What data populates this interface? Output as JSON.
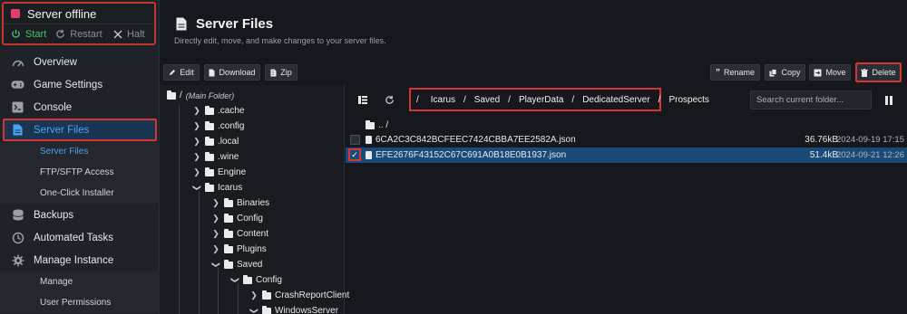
{
  "server": {
    "status": "Server offline",
    "start": "Start",
    "restart": "Restart",
    "halt": "Halt"
  },
  "nav": {
    "overview": "Overview",
    "game_settings": "Game Settings",
    "console": "Console",
    "server_files": "Server Files",
    "sub_server_files": "Server Files",
    "sub_ftp": "FTP/SFTP Access",
    "sub_installer": "One-Click Installer",
    "backups": "Backups",
    "automated_tasks": "Automated Tasks",
    "manage_instance": "Manage Instance",
    "sub_manage": "Manage",
    "sub_permissions": "User Permissions"
  },
  "page": {
    "title": "Server Files",
    "subtitle": "Directly edit, move, and make changes to your server files."
  },
  "toolbar": {
    "edit": "Edit",
    "download": "Download",
    "zip": "Zip",
    "rename": "Rename",
    "copy": "Copy",
    "move": "Move",
    "delete": "Delete"
  },
  "tree": {
    "root_slash": "/",
    "root_label": "(Main Folder)",
    "cache": ".cache",
    "config_dot": ".config",
    "local": ".local",
    "wine": ".wine",
    "engine": "Engine",
    "icarus": "Icarus",
    "binaries": "Binaries",
    "config": "Config",
    "content": "Content",
    "plugins": "Plugins",
    "saved": "Saved",
    "saved_config": "Config",
    "crash": "CrashReportClient",
    "windows": "WindowsServer"
  },
  "breadcrumb": {
    "root": "/",
    "p1": "Icarus",
    "p2": "Saved",
    "p3": "PlayerData",
    "p4": "DedicatedServer",
    "p5": "Prospects",
    "sep": "/"
  },
  "search": {
    "placeholder": "Search current folder..."
  },
  "files": {
    "parent": ".. /",
    "rows": [
      {
        "name": "6CA2C3C842BCFEEC7424CBBA7EE2582A.json",
        "size": "36.76kB",
        "date": "2024-09-19 17:15",
        "selected": false
      },
      {
        "name": "EFE2676F43152C67C691A0B18E0B1937.json",
        "size": "51.4kB",
        "date": "2024-09-21 12:26",
        "selected": true
      }
    ]
  },
  "colors": {
    "accent": "#4aa3f0",
    "highlight_border": "#d63535",
    "selected_row": "#1a4b78",
    "online_green": "#4cc26a",
    "offline_indicator": "#e0406a"
  }
}
